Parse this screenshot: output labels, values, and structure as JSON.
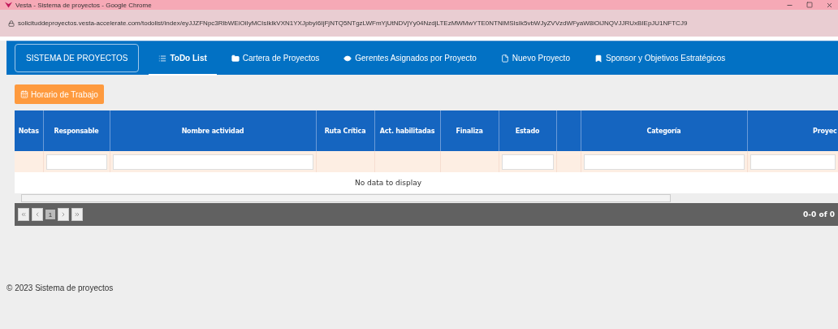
{
  "window": {
    "title": "Vesta - Sistema de proyectos - Google Chrome",
    "url": "solicituddeproyectos.vesta-accelerate.com/todolist/index/eyJJZFNpc3RlbWEiOiIyMCIsIklkVXN1YXJpbyI6IjFjNTQ5NTgzLWFmYjUtNDVjYy04NzdjLTEzMWMwYTE0NTNlMSIsIk5vbWJyZVVzdWFyaW8iOiJNQVJJRUxBIEpJU1NFTCJ9"
  },
  "navbar": {
    "brand": "SISTEMA DE PROYECTOS",
    "items": [
      {
        "label": "ToDo List",
        "selected": true
      },
      {
        "label": "Cartera de Proyectos",
        "selected": false
      },
      {
        "label": "Gerentes Asignados por Proyecto",
        "selected": false
      },
      {
        "label": "Nuevo Proyecto",
        "selected": false
      },
      {
        "label": "Sponsor y Objetivos Estratégicos",
        "selected": false
      }
    ]
  },
  "schedule_button": "Horario de Trabajo",
  "table": {
    "columns": [
      {
        "label": "Notas",
        "filter": false
      },
      {
        "label": "Responsable",
        "filter": true
      },
      {
        "label": "Nombre actividad",
        "filter": true
      },
      {
        "label": "Ruta Crítica",
        "filter": false
      },
      {
        "label": "Act. habilitadas",
        "filter": false
      },
      {
        "label": "Finaliza",
        "filter": false
      },
      {
        "label": "Estado",
        "filter": true
      },
      {
        "filter": false
      },
      {
        "label": "Categoría",
        "filter": true
      },
      {
        "label": "Proyec",
        "filter": true
      }
    ],
    "empty_message": "No data to display",
    "pager": {
      "current_page": "1",
      "summary": "0-0 of 0"
    }
  },
  "footer": "© 2023 Sistema de proyectos"
}
